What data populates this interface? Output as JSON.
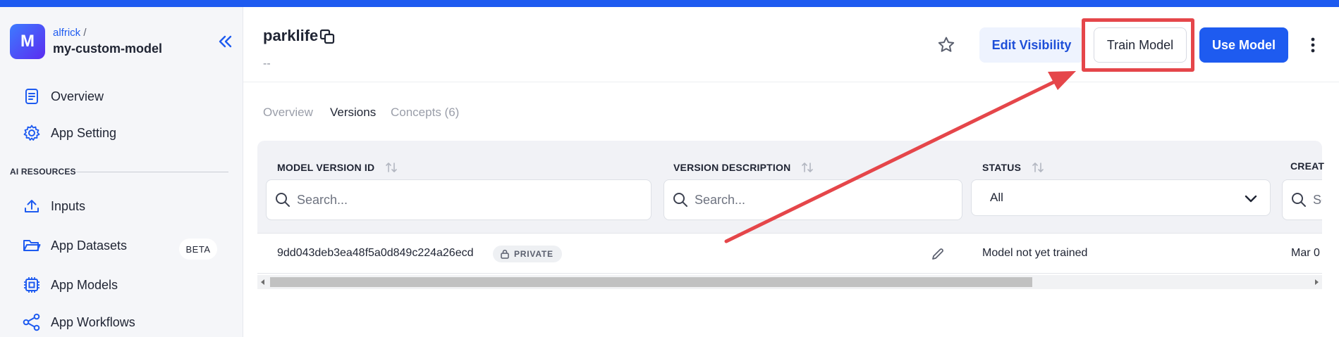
{
  "app": {
    "avatar_letter": "M",
    "owner": "alfrick",
    "separator": "/",
    "name": "my-custom-model"
  },
  "sidebar": {
    "section_label": "AI RESOURCES",
    "items": [
      {
        "label": "Overview",
        "icon": "document-icon"
      },
      {
        "label": "App Setting",
        "icon": "gear-icon"
      },
      {
        "label": "Inputs",
        "icon": "upload-icon"
      },
      {
        "label": "App Datasets",
        "icon": "folder-icon",
        "badge": "BETA"
      },
      {
        "label": "App Models",
        "icon": "chip-icon"
      },
      {
        "label": "App Workflows",
        "icon": "workflow-icon"
      }
    ]
  },
  "model": {
    "title": "parklife",
    "description": "--"
  },
  "header_actions": {
    "edit_visibility": "Edit Visibility",
    "train_model": "Train Model",
    "use_model": "Use Model"
  },
  "tabs": [
    {
      "label": "Overview",
      "active": false
    },
    {
      "label": "Versions",
      "active": true
    },
    {
      "label": "Concepts (6)",
      "active": false
    }
  ],
  "table": {
    "columns": [
      "MODEL VERSION ID",
      "VERSION DESCRIPTION",
      "STATUS",
      "CREAT"
    ],
    "search_placeholder": "Search...",
    "search_placeholder_cut": "Se",
    "status_filter": "All",
    "rows": [
      {
        "version_id": "9dd043deb3ea48f5a0d849c224a26ecd",
        "visibility": "PRIVATE",
        "description": "",
        "status": "Model not yet trained",
        "created": "Mar 0"
      }
    ]
  },
  "colors": {
    "brand": "#1e5bf0",
    "annotation": "#e5464a"
  }
}
